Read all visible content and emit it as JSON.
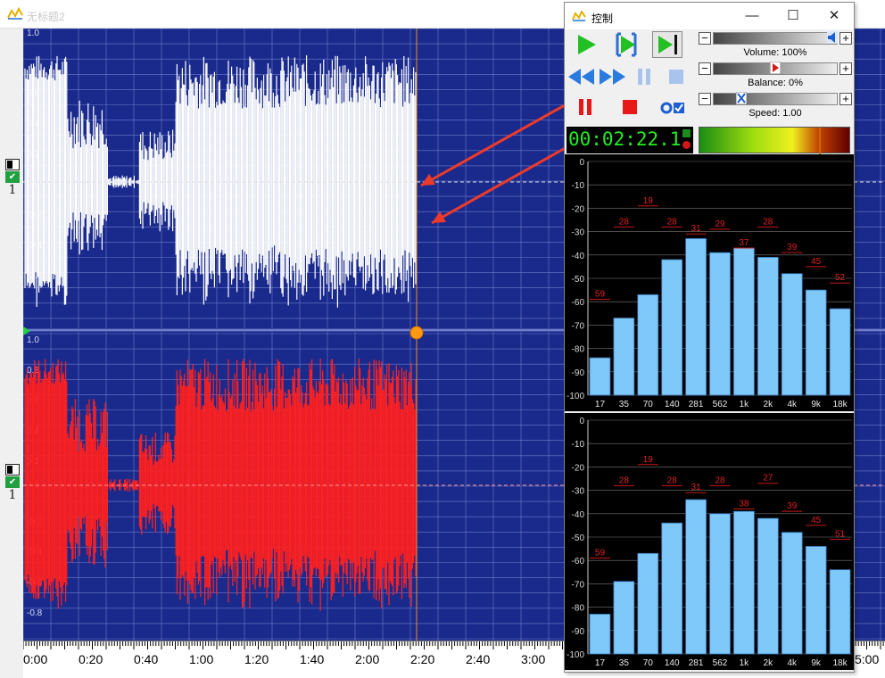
{
  "window": {
    "title": "无标题2"
  },
  "panel": {
    "title": "控制",
    "minimize": "—",
    "maximize": "☐",
    "close": "✕",
    "volume": {
      "label": "Volume: 100%",
      "value": 1.0
    },
    "balance": {
      "label": "Balance: 0%",
      "value": 0.0
    },
    "speed": {
      "label": "Speed: 1.00",
      "value": 1.0
    },
    "plus": "+",
    "minus": "−",
    "time": "00:02:22.1",
    "vu_level": 0.79
  },
  "channels": [
    {
      "number": "1",
      "check": "✔"
    },
    {
      "number": "1",
      "check": "✔"
    }
  ],
  "timeline": {
    "labels": [
      "0:00",
      "0:20",
      "0:40",
      "1:00",
      "1:20",
      "1:40",
      "2:00",
      "2:20",
      "2:40",
      "3:00",
      "5:00"
    ],
    "cursor": "2:22"
  },
  "waveform_axis": {
    "ch1": [
      "1.0",
      "0.6",
      "0.4",
      "0.2",
      "0.0",
      "-0.2",
      "-0.4",
      "-0.6"
    ],
    "ch2": [
      "1.0",
      "0.8",
      "0.6",
      "0.4",
      "0.2",
      "0.0",
      "-0.2",
      "-0.4",
      "-0.6",
      "-0.8"
    ]
  },
  "chart_data": [
    {
      "type": "bar",
      "categories": [
        "17",
        "35",
        "70",
        "140",
        "281",
        "562",
        "1k",
        "2k",
        "4k",
        "9k",
        "18k"
      ],
      "values": [
        -84,
        -67,
        -57,
        -42,
        -33,
        -39,
        -37,
        -41,
        -48,
        -55,
        -63
      ],
      "peaks": [
        59,
        28,
        19,
        28,
        31,
        29,
        37,
        28,
        39,
        45,
        52
      ],
      "yticks": [
        "0",
        "-10",
        "-20",
        "-30",
        "-40",
        "-50",
        "-60",
        "-70",
        "-80",
        "-90",
        "-100"
      ],
      "ylim": [
        -100,
        0
      ]
    },
    {
      "type": "bar",
      "categories": [
        "17",
        "35",
        "70",
        "140",
        "281",
        "562",
        "1k",
        "2k",
        "4k",
        "9k",
        "18k"
      ],
      "values": [
        -83,
        -69,
        -57,
        -44,
        -34,
        -40,
        -39,
        -42,
        -48,
        -54,
        -64
      ],
      "peaks": [
        59,
        28,
        19,
        28,
        31,
        28,
        38,
        27,
        39,
        45,
        51
      ],
      "yticks": [
        "0",
        "-10",
        "-20",
        "-30",
        "-40",
        "-50",
        "-60",
        "-70",
        "-80",
        "-90",
        "-100"
      ],
      "ylim": [
        -100,
        0
      ]
    }
  ]
}
